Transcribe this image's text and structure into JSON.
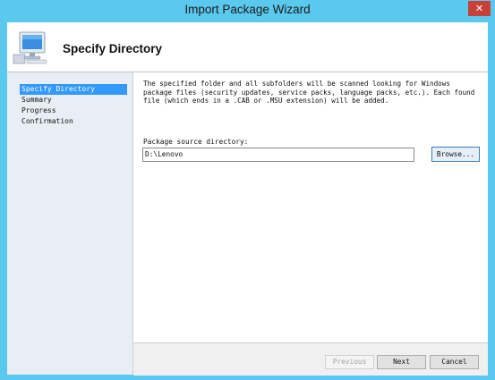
{
  "window": {
    "title": "Import Package Wizard",
    "close_glyph": "✕"
  },
  "header": {
    "title": "Specify Directory",
    "icon": "computer-monitor-icon"
  },
  "nav": {
    "items": [
      {
        "label": "Specify Directory",
        "active": true
      },
      {
        "label": "Summary",
        "active": false
      },
      {
        "label": "Progress",
        "active": false
      },
      {
        "label": "Confirmation",
        "active": false
      }
    ]
  },
  "main": {
    "description": "The specified folder and all subfolders will be scanned looking for Windows package files (security updates, service packs, language packs, etc.).  Each found file (which ends in a .CAB or .MSU extension) will be added.",
    "source_label": "Package source directory:",
    "source_value": "D:\\Lenovo",
    "browse_label": "Browse..."
  },
  "footer": {
    "previous_label": "Previous",
    "next_label": "Next",
    "cancel_label": "Cancel"
  },
  "colors": {
    "frame": "#5bc8ee",
    "selection": "#3399ff",
    "close": "#c7403a"
  }
}
